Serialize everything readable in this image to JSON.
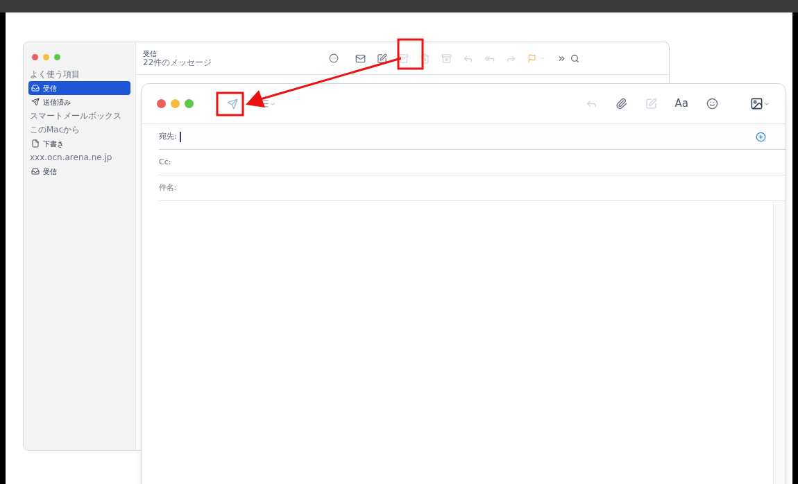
{
  "mail_window": {
    "sidebar": [
      {
        "kind": "heading",
        "label": "よく使う項目"
      },
      {
        "kind": "inbox",
        "label": "受信",
        "selected": true
      },
      {
        "kind": "sent",
        "label": "送信済み",
        "selected": false
      },
      {
        "kind": "heading",
        "label": "スマートメールボックス"
      },
      {
        "kind": "heading",
        "label": "このMacから"
      },
      {
        "kind": "draft",
        "label": "下書き",
        "selected": false
      },
      {
        "kind": "heading",
        "label": "xxx.ocn.arena.ne.jp"
      },
      {
        "kind": "inbox",
        "label": "受信",
        "selected": false
      }
    ],
    "mailbox_title": "受信",
    "message_count": "22件のメッセージ"
  },
  "compose_window": {
    "format_label": "Aa",
    "fields": [
      {
        "label": "宛先:",
        "focused": true
      },
      {
        "label": "Cc:",
        "focused": false
      },
      {
        "label": "件名:",
        "focused": false
      }
    ]
  }
}
